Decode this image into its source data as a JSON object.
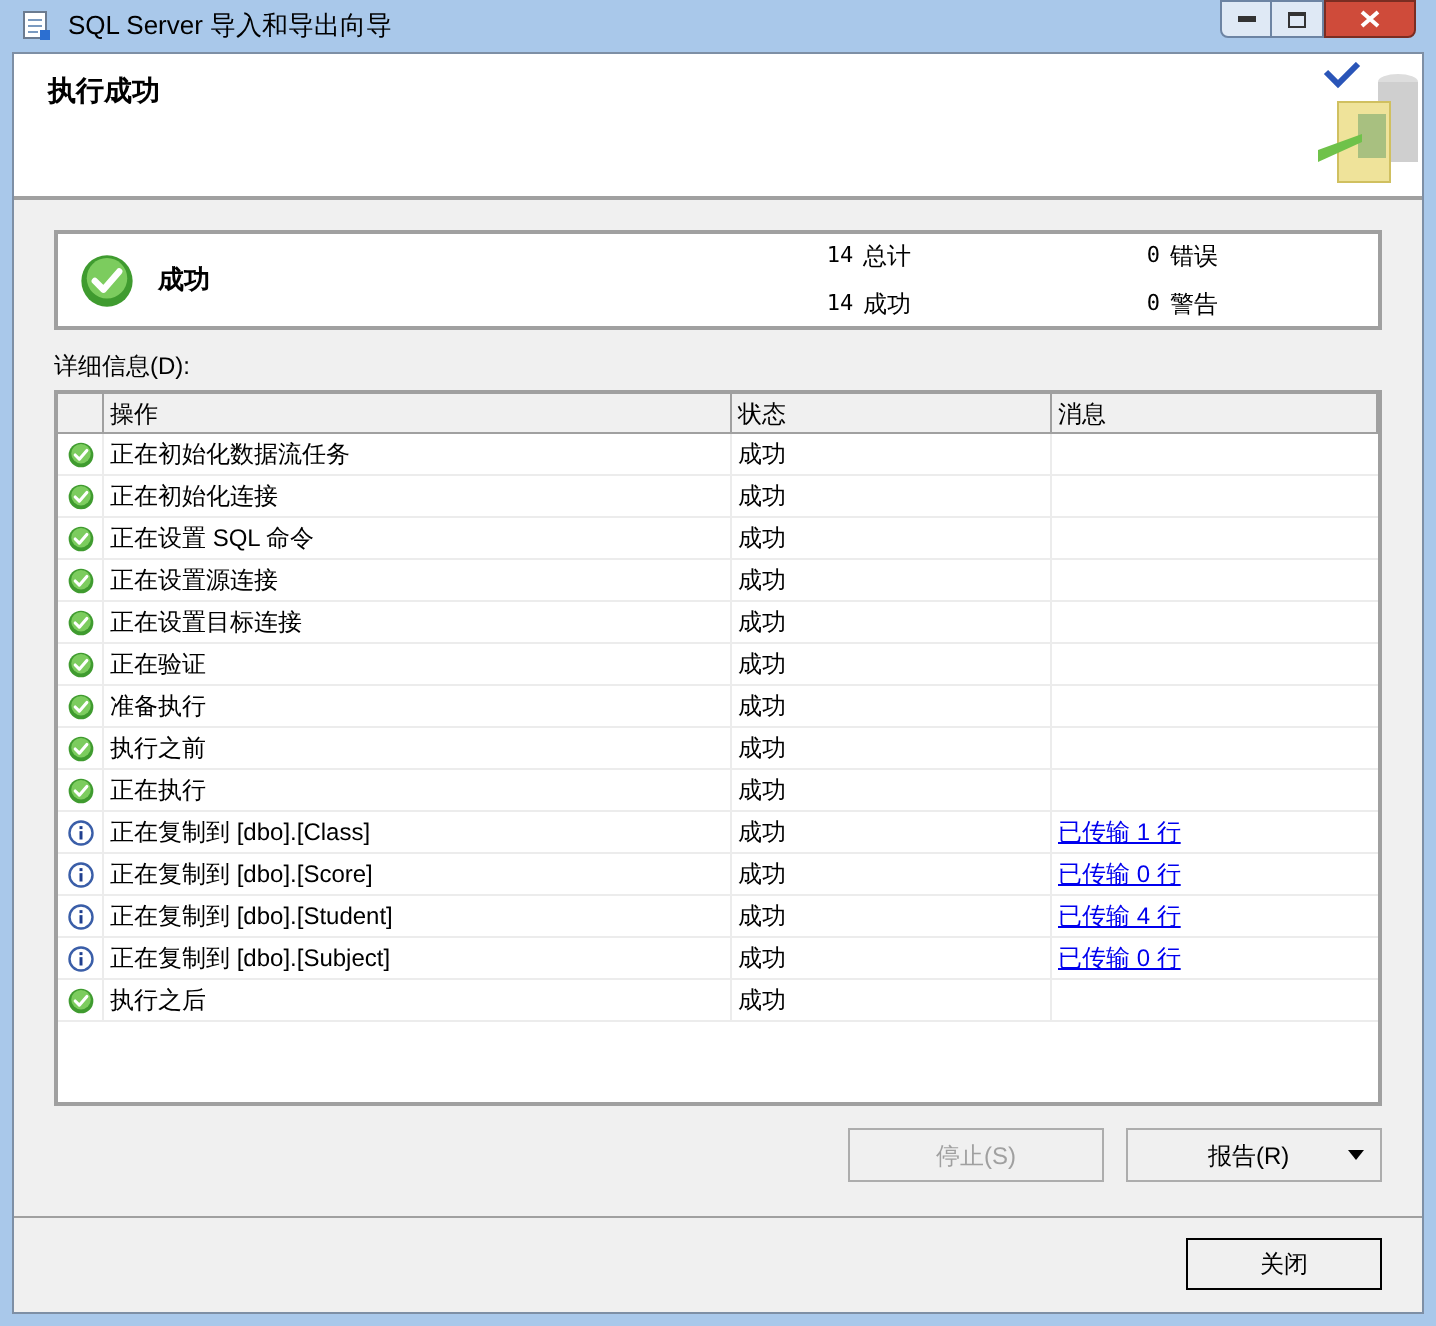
{
  "window": {
    "title": "SQL Server 导入和导出向导"
  },
  "header": {
    "title": "执行成功"
  },
  "summary": {
    "status": "成功",
    "stats": [
      {
        "value": "14",
        "label": "总计"
      },
      {
        "value": "0",
        "label": "错误"
      },
      {
        "value": "14",
        "label": "成功"
      },
      {
        "value": "0",
        "label": "警告"
      }
    ]
  },
  "details_label": "详细信息(D):",
  "table": {
    "columns": [
      "操作",
      "状态",
      "消息"
    ],
    "rows": [
      {
        "kind": "success",
        "action": "正在初始化数据流任务",
        "status": "成功"
      },
      {
        "kind": "success",
        "action": "正在初始化连接",
        "status": "成功"
      },
      {
        "kind": "success",
        "action": "正在设置 SQL 命令",
        "status": "成功"
      },
      {
        "kind": "success",
        "action": "正在设置源连接",
        "status": "成功"
      },
      {
        "kind": "success",
        "action": "正在设置目标连接",
        "status": "成功"
      },
      {
        "kind": "success",
        "action": "正在验证",
        "status": "成功"
      },
      {
        "kind": "success",
        "action": "准备执行",
        "status": "成功"
      },
      {
        "kind": "success",
        "action": "执行之前",
        "status": "成功"
      },
      {
        "kind": "success",
        "action": "正在执行",
        "status": "成功"
      },
      {
        "kind": "info",
        "action": "正在复制到 [dbo].[Class]",
        "status": "成功",
        "message": "已传输 1 行"
      },
      {
        "kind": "info",
        "action": "正在复制到 [dbo].[Score]",
        "status": "成功",
        "message": "已传输 0 行"
      },
      {
        "kind": "info",
        "action": "正在复制到 [dbo].[Student]",
        "status": "成功",
        "message": "已传输 4 行"
      },
      {
        "kind": "info",
        "action": "正在复制到 [dbo].[Subject]",
        "status": "成功",
        "message": "已传输 0 行"
      },
      {
        "kind": "success",
        "action": "执行之后",
        "status": "成功"
      }
    ]
  },
  "buttons": {
    "stop": {
      "label": "停止(S)",
      "disabled": true
    },
    "report": {
      "label": "报告(R)"
    },
    "close": {
      "label": "关闭"
    }
  }
}
